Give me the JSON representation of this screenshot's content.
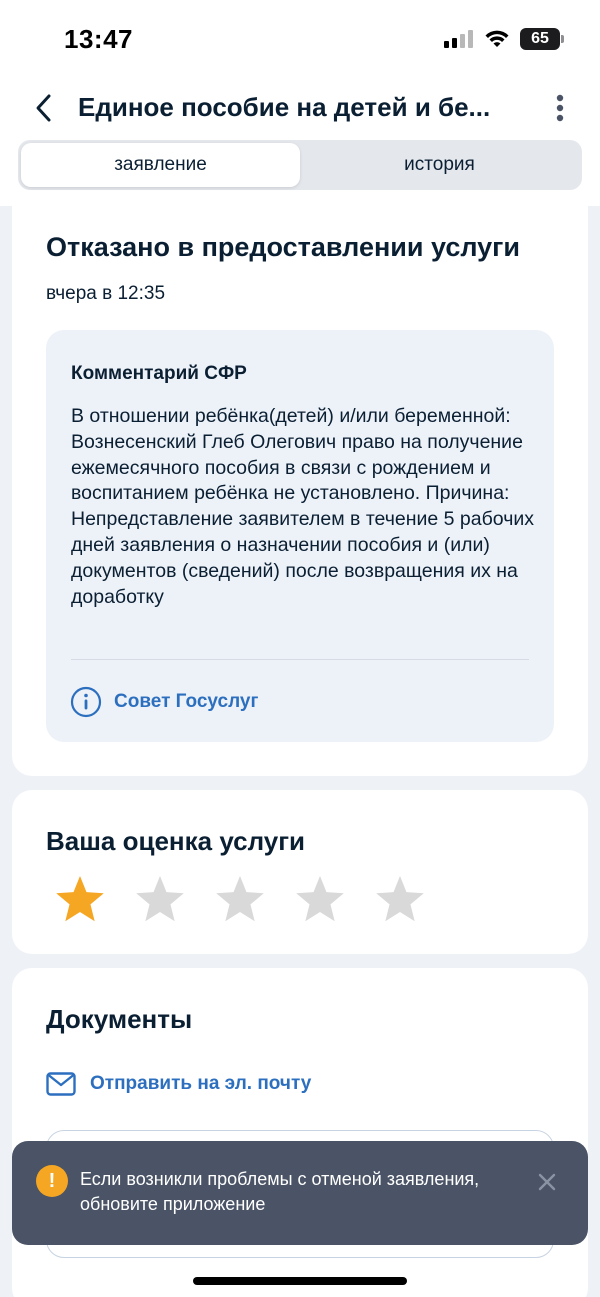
{
  "status_bar": {
    "time": "13:47",
    "battery": "65"
  },
  "header": {
    "title": "Единое пособие на детей и бе..."
  },
  "tabs": [
    {
      "label": "заявление",
      "active": true
    },
    {
      "label": "история",
      "active": false
    }
  ],
  "status_card": {
    "title": "Отказано в предоставлении услуги",
    "date": "вчера в 12:35",
    "comment": {
      "title": "Комментарий СФР",
      "text": "В отношении ребёнка(детей) и/или беременной: Вознесенский Глеб Олегович право на получение ежемесячного пособия в связи с рождением и воспитанием ребёнка не установлено. Причина: Непредставление заявителем в течение 5 рабочих дней заявления о назначении пособия и (или) документов (сведений) после возвращения их на доработку",
      "advice_link": "Совет Госуслуг"
    }
  },
  "rating_card": {
    "title": "Ваша оценка услуги",
    "rating": 1,
    "max_rating": 5
  },
  "documents_card": {
    "title": "Документы",
    "email_link": "Отправить на эл. почту"
  },
  "toast": {
    "icon": "!",
    "text": "Если возникли проблемы с отменой заявления, обновите приложение"
  },
  "colors": {
    "accent": "#2d6fbf",
    "star_filled": "#f5a623",
    "star_empty": "#d9d9d9",
    "toast_bg": "#4a5466"
  }
}
